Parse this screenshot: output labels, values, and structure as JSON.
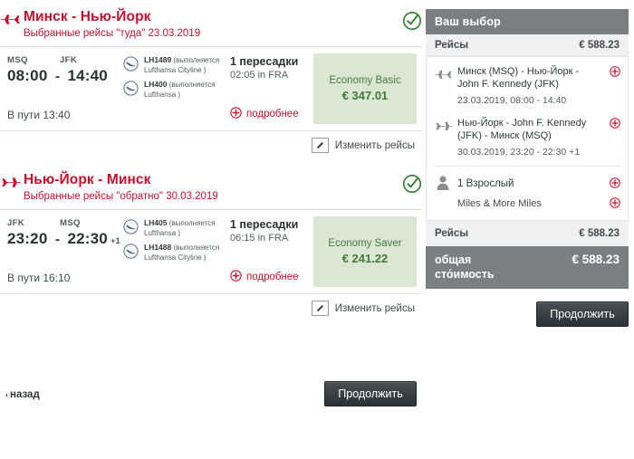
{
  "colors": {
    "brand_red": "#c8102e",
    "fare_box_bg": "#dbe7d2",
    "fare_green": "#3f7a3a",
    "sidebar_gray": "#7b7f82",
    "check_green": "#2e7d32"
  },
  "segments": [
    {
      "direction_icon": "plane-right-icon",
      "title": "Минск - Нью-Йорк",
      "subtitle": "Выбранные рейсы \"туда\" 23.03.2019",
      "status_icon": "check-circle-icon",
      "from_code": "MSQ",
      "to_code": "JFK",
      "depart_time": "08:00",
      "dash": "-",
      "arrive_time": "14:40",
      "day_offset": "",
      "duration": "В пути 13:40",
      "carriers": [
        {
          "flight_no": "LH1489",
          "operator": "(выполняется Lufthansa Cityline )"
        },
        {
          "flight_no": "LH400",
          "operator": "(выполняется Lufthansa )"
        }
      ],
      "stops": "1 пересадки",
      "stop_info": "02:05 in FRA",
      "more_label": "подробнее",
      "fare_name": "Economy Basic",
      "fare_price": "€ 347.01",
      "edit_label": "Изменить рейсы"
    },
    {
      "direction_icon": "plane-left-icon",
      "title": "Нью-Йорк - Минск",
      "subtitle": "Выбранные рейсы \"обратно\" 30.03.2019",
      "status_icon": "check-circle-icon",
      "from_code": "JFK",
      "to_code": "MSQ",
      "depart_time": "23:20",
      "dash": "-",
      "arrive_time": "22:30",
      "day_offset": "+1",
      "duration": "В пути 16:10",
      "carriers": [
        {
          "flight_no": "LH405",
          "operator": "(выполняется Lufthansa )"
        },
        {
          "flight_no": "LH1488",
          "operator": "(выполняется Lufthansa Cityline )"
        }
      ],
      "stops": "1 пересадки",
      "stop_info": "06:15 in FRA",
      "more_label": "подробнее",
      "fare_name": "Economy Saver",
      "fare_price": "€ 241.22",
      "edit_label": "Изменить рейсы"
    }
  ],
  "bottom": {
    "back_label": "назад",
    "back_chevron": "‹",
    "continue_label": "Продолжить"
  },
  "sidebar": {
    "header": "Ваш выбор",
    "flights_label": "Рейсы",
    "flights_total": "€ 588.23",
    "items": [
      {
        "icon": "plane-right-icon",
        "route": "Минск (MSQ) - Нью-Йорк - John F. Kennedy (JFK)",
        "datetime": "23.03.2019, 08:00 - 14:40",
        "action_icon": "plus-circle-icon"
      },
      {
        "icon": "plane-left-icon",
        "route": "Нью-Йорк - John F. Kennedy (JFK) - Минск (MSQ)",
        "datetime": "30.03.2019, 23:20 - 22:30 +1",
        "action_icon": "plus-circle-icon"
      }
    ],
    "passenger": {
      "icon": "person-icon",
      "label": "1 Взрослый",
      "program": "Miles & More Miles",
      "action_icon": "plus-circle-icon"
    },
    "subtotal_label": "Рейсы",
    "subtotal_value": "€ 588.23",
    "grand_label": "общая сто́имость",
    "grand_value": "€ 588.23",
    "continue_label": "Продолжить"
  }
}
